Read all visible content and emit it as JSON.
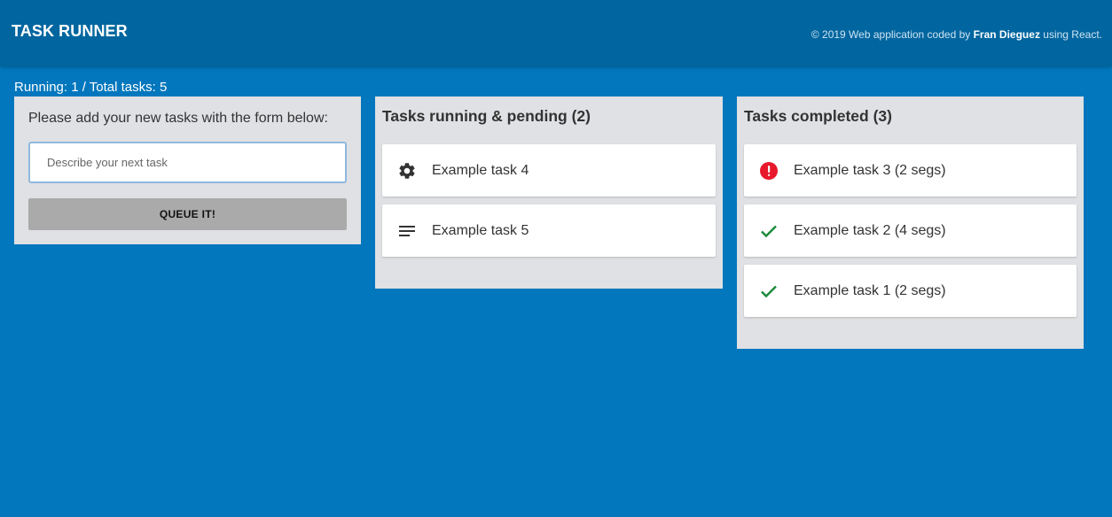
{
  "header": {
    "title": "TASK RUNNER",
    "credits_prefix": "© 2019 Web application coded by ",
    "credits_author": "Fran Dieguez",
    "credits_suffix": " using React."
  },
  "stats": {
    "text": "Running: 1 / Total tasks: 5"
  },
  "form": {
    "caption": "Please add your new tasks with the form below:",
    "placeholder": "Describe your next task",
    "value": "",
    "button_label": "QUEUE IT!"
  },
  "running": {
    "title": "Tasks running & pending (2)",
    "tasks": [
      {
        "label": "Example task 4",
        "icon": "gear-icon"
      },
      {
        "label": "Example task 5",
        "icon": "queue-lines-icon"
      }
    ]
  },
  "completed": {
    "title": "Tasks completed (3)",
    "tasks": [
      {
        "label": "Example task 3 (2 segs)",
        "icon": "error-icon"
      },
      {
        "label": "Example task 2 (4 segs)",
        "icon": "check-icon"
      },
      {
        "label": "Example task 1 (2 segs)",
        "icon": "check-icon"
      }
    ]
  },
  "colors": {
    "background": "#0277bd",
    "app_bar": "#01669f",
    "panel": "#dfe1e4",
    "error": "#e8192c",
    "success": "#1a8a3a",
    "icon_dark": "#333333"
  }
}
